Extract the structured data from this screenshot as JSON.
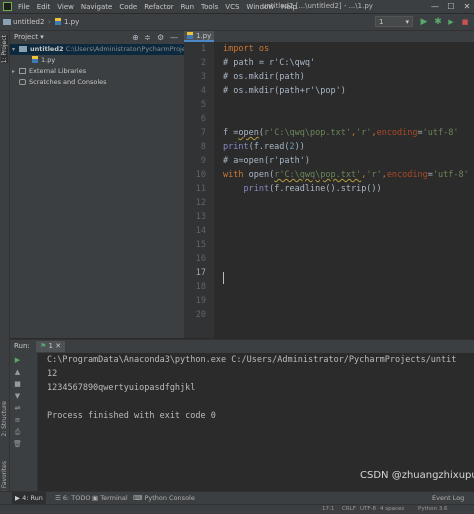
{
  "menubar": {
    "items": [
      "File",
      "Edit",
      "View",
      "Navigate",
      "Code",
      "Refactor",
      "Run",
      "Tools",
      "VCS",
      "Window",
      "Help"
    ],
    "window_title": "untitled2 [...\\untitled2] - ...\\1.py",
    "minimize": "—",
    "maximize": "☐",
    "close": "✕"
  },
  "navbar": {
    "project_crumb": "untitled2",
    "file_crumb": "1.py",
    "run_config": "1",
    "run_config_arrow": "▾",
    "run_icon": "▶",
    "debug_icon": "✱",
    "coverage_icon": "▶",
    "stop_icon": "■",
    "search_icon": "⚲"
  },
  "left_stripe": {
    "project": "1: Project",
    "structure": "2: Structure",
    "favorites": "2: Favorites"
  },
  "project_panel": {
    "label": "Project",
    "dropdown": "▾",
    "tools": [
      "⊕",
      "≑",
      "⚙",
      "—"
    ],
    "tree": [
      {
        "arrow": "▾",
        "name": "untitled2",
        "path": "C:\\Users\\Administrator\\PycharmProjects\\untitled2"
      },
      {
        "arrow": "",
        "name": "1.py"
      },
      {
        "arrow": "▸",
        "name": "External Libraries"
      },
      {
        "arrow": "",
        "name": "Scratches and Consoles"
      }
    ]
  },
  "editor": {
    "tab_label": "1.py",
    "line_numbers": [
      "1",
      "2",
      "3",
      "4",
      "5",
      "6",
      "7",
      "8",
      "9",
      "10",
      "11",
      "12",
      "13",
      "14",
      "15",
      "16",
      "17",
      "18",
      "19",
      "20"
    ],
    "lines": {
      "l1": "import os",
      "l2": "# path = r'C:\\qwq'",
      "l3": "# os.mkdir(path)",
      "l4": "# os.mkdir(path+r'\\pop')",
      "l7a": "f =",
      "l7b": "open",
      "l7c": "(",
      "l7d": "r'C:\\qwq\\pop.txt'",
      "l7e": ",",
      "l7f": "'r'",
      "l7g": ",",
      "l7h": "encoding",
      "l7i": "=",
      "l7j": "'utf-8'",
      "l8a": "print",
      "l8b": "(f.read(",
      "l8c": "2",
      "l8d": "))",
      "l9": "# a=open(r'path')",
      "l12a": "with",
      "l12b": " open(",
      "l12c": "r'C:\\qwq\\pop.txt'",
      "l12d": ",",
      "l12e": "'r'",
      "l12f": ",",
      "l12g": "encoding",
      "l12h": "=",
      "l12i": "'utf-8'",
      "l13a": "    ",
      "l13b": "print",
      "l13c": "(f.readline().strip())"
    }
  },
  "run_panel": {
    "label": "Run:",
    "tab_label": "1",
    "tab_close": "✕",
    "tools": [
      "▶",
      "▲",
      "■",
      "▼",
      "⇌",
      "≡",
      "⎙",
      "🗑"
    ],
    "output": [
      "C:\\ProgramData\\Anaconda3\\python.exe C:/Users/Administrator/PycharmProjects/untit",
      "12",
      "1234567890qwertyuiopasdfghjkl",
      "",
      "Process finished with exit code 0"
    ]
  },
  "bottom_tabs": {
    "run": "▶ 4: Run",
    "todo": "☰ 6: TODO",
    "terminal": "▣ Terminal",
    "python_console": "⌨ Python Console",
    "event_log": "Event Log"
  },
  "status_bar": {
    "position": "17:1",
    "line_sep": "CRLF",
    "encoding": "UTF-8",
    "indent": "4 spaces",
    "interpreter": "Python 3.6"
  },
  "watermark": "CSDN @zhuangzhixupufu"
}
